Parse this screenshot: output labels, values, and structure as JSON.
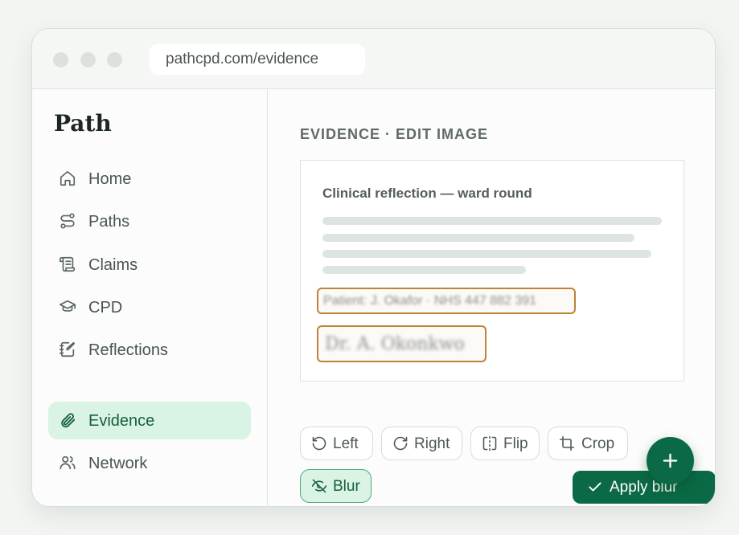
{
  "browser": {
    "url": "pathcpd.com/evidence"
  },
  "sidebar": {
    "brand": "Path",
    "items": [
      {
        "label": "Home",
        "icon": "home-icon"
      },
      {
        "label": "Paths",
        "icon": "route-icon"
      },
      {
        "label": "Claims",
        "icon": "scroll-icon"
      },
      {
        "label": "CPD",
        "icon": "graduation-cap-icon"
      },
      {
        "label": "Reflections",
        "icon": "notebook-pen-icon"
      },
      {
        "label": "Evidence",
        "icon": "paperclip-icon",
        "active": true
      },
      {
        "label": "Network",
        "icon": "users-icon"
      }
    ]
  },
  "main": {
    "section_title": "EVIDENCE · EDIT IMAGE",
    "document": {
      "title": "Clinical reflection — ward round",
      "redacted_patient": "Patient: J. Okafor · NHS 447 882 391",
      "redacted_signature": "Dr. A. Okonkwo"
    },
    "tools": {
      "left": "Left",
      "right": "Right",
      "flip": "Flip",
      "crop": "Crop",
      "blur": "Blur"
    },
    "apply_label": "Apply blur"
  },
  "colors": {
    "accent": "#0b6a45",
    "active_bg": "#d9f3e4",
    "redaction_border": "#c08236"
  }
}
